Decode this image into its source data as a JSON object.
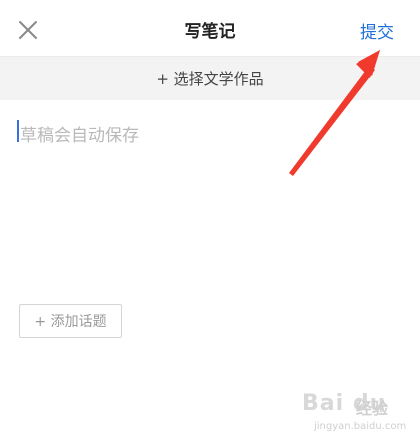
{
  "header": {
    "title": "写笔记",
    "submit_label": "提交",
    "close_icon": "close-icon"
  },
  "select_bar": {
    "label": "+ 选择文学作品"
  },
  "editor": {
    "placeholder": "草稿会自动保存"
  },
  "topic_button": {
    "label": "+ 添加话题"
  },
  "annotation": {
    "arrow_color": "#f03a2e"
  },
  "watermark": {
    "logo": "Bai du",
    "text": "经验",
    "url": "jingyan.baidu.com"
  },
  "colors": {
    "accent": "#1e6fd9",
    "placeholder": "#b9b9b9",
    "bar_bg": "#f3f3f3"
  }
}
